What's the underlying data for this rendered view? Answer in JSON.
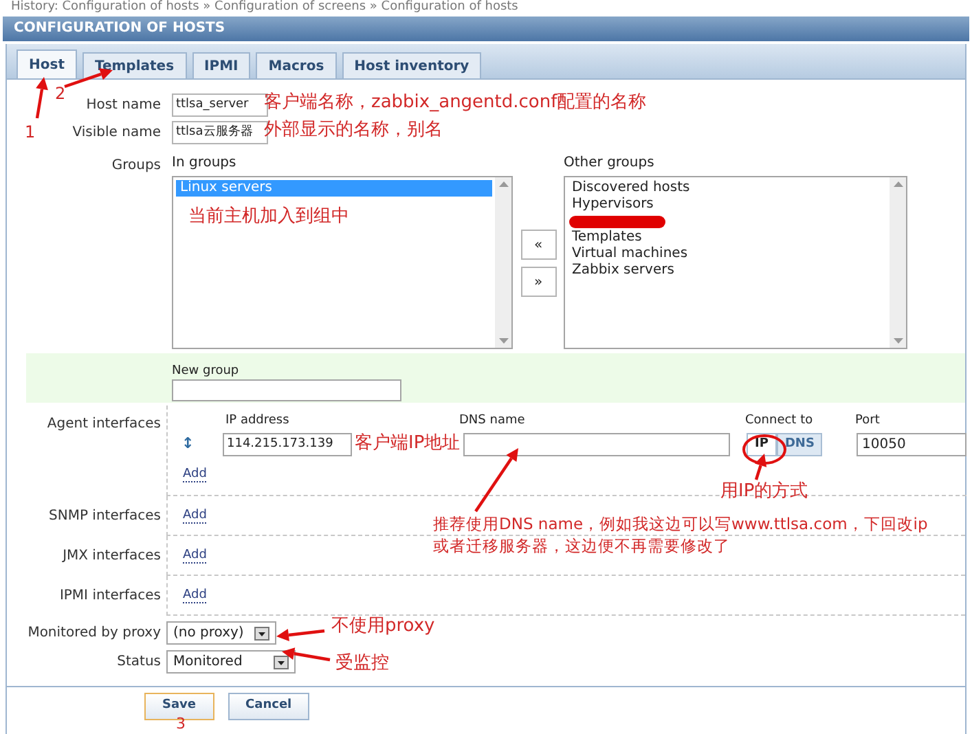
{
  "history": "History: Configuration of hosts » Configuration of screens » Configuration of hosts",
  "header": "CONFIGURATION OF HOSTS",
  "tabs": [
    {
      "label": "Host",
      "selected": true
    },
    {
      "label": "Templates",
      "selected": false
    },
    {
      "label": "IPMI",
      "selected": false
    },
    {
      "label": "Macros",
      "selected": false
    },
    {
      "label": "Host inventory",
      "selected": false
    }
  ],
  "host_name": {
    "label": "Host name",
    "value": "ttlsa_server"
  },
  "visible_name": {
    "label": "Visible name",
    "value": "ttlsa云服务器"
  },
  "groups": {
    "label": "Groups",
    "in_groups": {
      "title": "In groups",
      "items": [
        {
          "kind": "text",
          "label": "Linux servers",
          "selected": true
        }
      ]
    },
    "move_buttons": [
      "«",
      "»"
    ],
    "other_groups": {
      "title": "Other groups",
      "items": [
        {
          "kind": "text",
          "label": "Discovered hosts",
          "selected": false
        },
        {
          "kind": "text",
          "label": "Hypervisors",
          "selected": false
        },
        {
          "kind": "redacted"
        },
        {
          "kind": "text",
          "label": "Templates",
          "selected": false
        },
        {
          "kind": "text",
          "label": "Virtual machines",
          "selected": false
        },
        {
          "kind": "text",
          "label": "Zabbix servers",
          "selected": false
        }
      ]
    }
  },
  "new_group": {
    "label": "New group"
  },
  "interfaces": [
    {
      "kind": "agent",
      "label": "Agent interfaces",
      "columns": [
        "IP address",
        "DNS name",
        "Connect to",
        "Port"
      ],
      "handle": "↕",
      "ip": "114.215.173.139",
      "connect": [
        {
          "label": "IP",
          "selected": true
        },
        {
          "label": "DNS",
          "selected": false
        }
      ],
      "port": "10050",
      "add": "Add"
    },
    {
      "kind": "empty",
      "label": "SNMP interfaces",
      "add": "Add"
    },
    {
      "kind": "empty",
      "label": "JMX interfaces",
      "add": "Add"
    },
    {
      "kind": "empty",
      "label": "IPMI interfaces",
      "add": "Add"
    }
  ],
  "proxy": {
    "label": "Monitored by proxy",
    "value": "(no proxy)"
  },
  "status": {
    "label": "Status",
    "value": "Monitored"
  },
  "buttons": [
    {
      "label": "Save",
      "focused": true
    },
    {
      "label": "Cancel",
      "focused": false
    }
  ],
  "annotations": [
    "1",
    "2",
    "客户端名称，zabbix_angentd.conf配置的名称",
    "外部显示的名称，别名",
    "当前主机加入到组中",
    "客户端IP地址",
    "用IP的方式",
    "推荐使用DNS name，例如我这边可以写www.ttlsa.com，下回改ip",
    "或者迁移服务器，这边便不再需要修改了",
    "不使用proxy",
    "受监控",
    "3"
  ]
}
